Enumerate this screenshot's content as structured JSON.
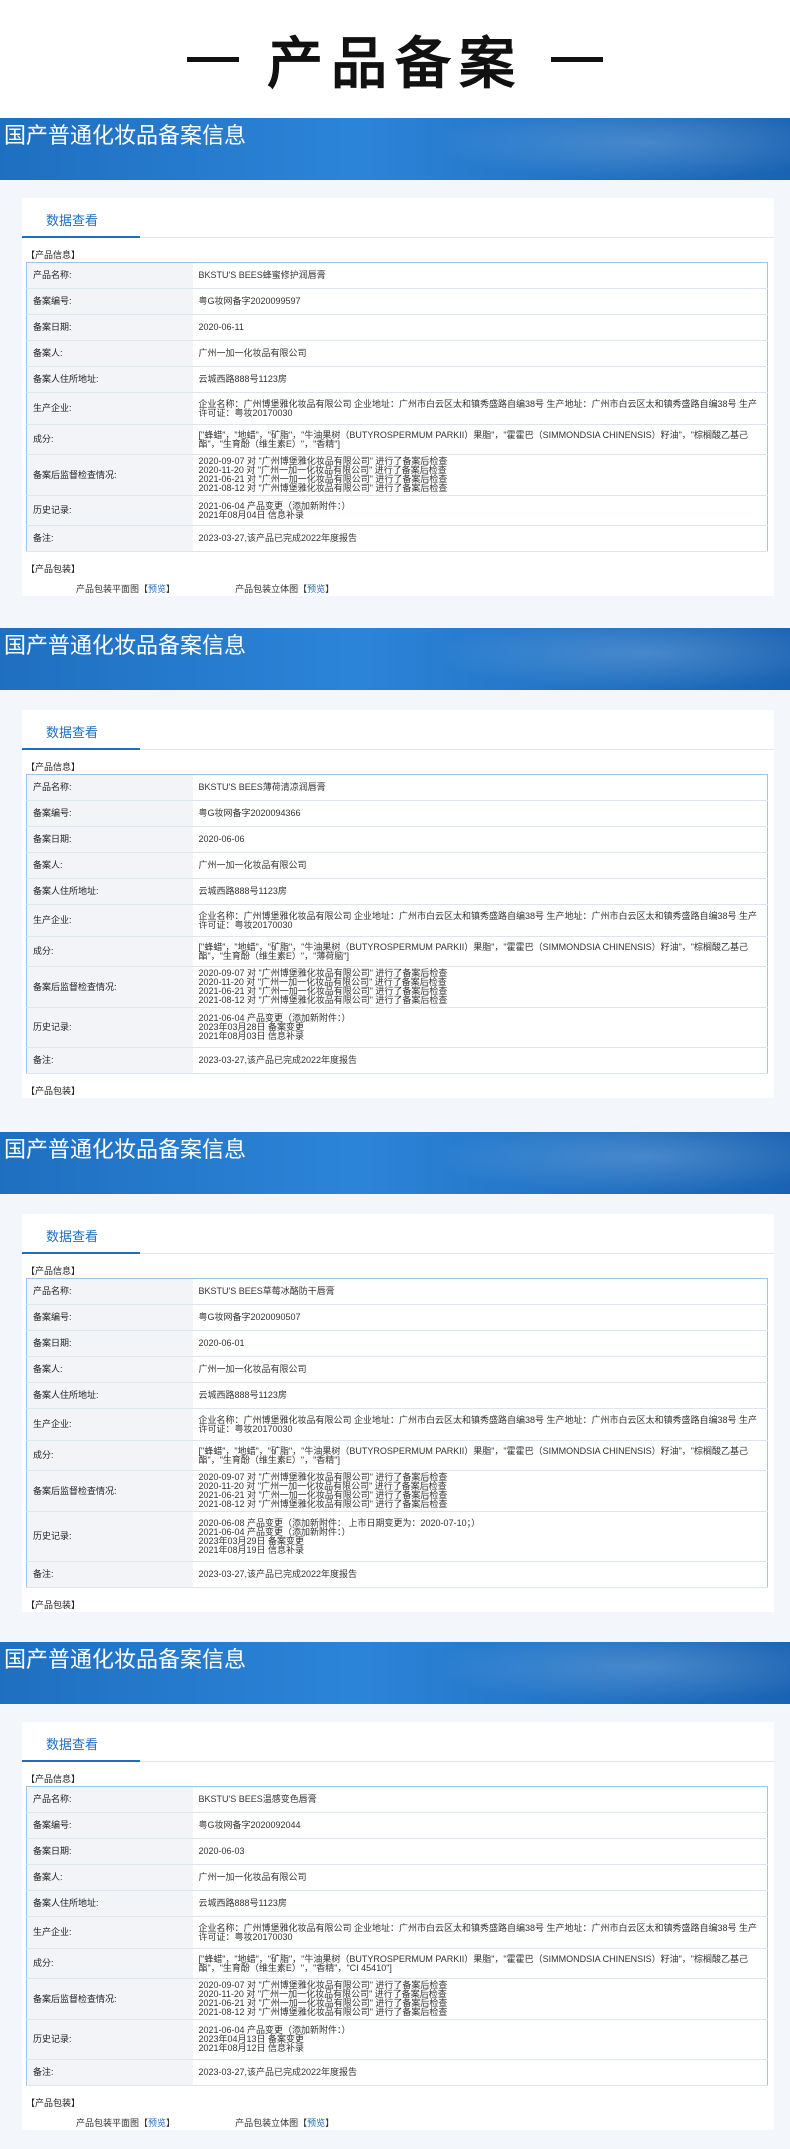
{
  "page_title": "产品备案",
  "records": [
    {
      "banner": "国产普通化妆品备案信息",
      "tab": "数据查看",
      "info_label": "【产品信息】",
      "rows": [
        {
          "k": "产品名称:",
          "v": "BKSTU'S BEES蜂蜜修护润唇膏"
        },
        {
          "k": "备案编号:",
          "v": "粤G妆网备字2020099597"
        },
        {
          "k": "备案日期:",
          "v": "2020-06-11"
        },
        {
          "k": "备案人:",
          "v": "广州一加一化妆品有限公司"
        },
        {
          "k": "备案人住所地址:",
          "v": "云城西路888号1123房"
        },
        {
          "k": "生产企业:",
          "v": "企业名称：广州博堡雅化妆品有限公司 企业地址：广州市白云区太和镇秀盛路自编38号 生产地址：广州市白云区太和镇秀盛路自编38号 生产许可证：粤妆20170030"
        },
        {
          "k": "成分:",
          "v": "[\"蜂蜡\"，\"地蜡\"，\"矿脂\"，\"牛油果树（BUTYROSPERMUM PARKII）果脂\"，\"霍霍巴（SIMMONDSIA CHINENSIS）籽油\"，\"棕榈酸乙基己酯\"，\"生育酚（维生素E）\"，\"香精\"]"
        },
        {
          "k": "备案后监督检查情况:",
          "v": "2020-09-07 对 \"广州博堡雅化妆品有限公司\" 进行了备案后检查\n2020-11-20 对 \"广州一加一化妆品有限公司\" 进行了备案后检查\n2021-06-21 对 \"广州一加一化妆品有限公司\" 进行了备案后检查\n2021-08-12 对 \"广州博堡雅化妆品有限公司\" 进行了备案后检查"
        },
        {
          "k": "历史记录:",
          "v": "2021-06-04 产品变更（添加新附件：）\n2021年08月04日 信息补录"
        },
        {
          "k": "备注:",
          "v": "2023-03-27,该产品已完成2022年度报告"
        }
      ],
      "pack_label": "【产品包装】",
      "pack_items": [
        {
          "name": "产品包装平面图",
          "link": "预览"
        },
        {
          "name": "产品包装立体图",
          "link": "预览"
        }
      ]
    },
    {
      "banner": "国产普通化妆品备案信息",
      "tab": "数据查看",
      "info_label": "【产品信息】",
      "rows": [
        {
          "k": "产品名称:",
          "v": "BKSTU'S BEES薄荷清凉润唇膏"
        },
        {
          "k": "备案编号:",
          "v": "粤G妆网备字2020094366"
        },
        {
          "k": "备案日期:",
          "v": "2020-06-06"
        },
        {
          "k": "备案人:",
          "v": "广州一加一化妆品有限公司"
        },
        {
          "k": "备案人住所地址:",
          "v": "云城西路888号1123房"
        },
        {
          "k": "生产企业:",
          "v": "企业名称：广州博堡雅化妆品有限公司 企业地址：广州市白云区太和镇秀盛路自编38号 生产地址：广州市白云区太和镇秀盛路自编38号 生产许可证：粤妆20170030"
        },
        {
          "k": "成分:",
          "v": "[\"蜂蜡\"，\"地蜡\"，\"矿脂\"，\"牛油果树（BUTYROSPERMUM PARKII）果脂\"，\"霍霍巴（SIMMONDSIA CHINENSIS）籽油\"，\"棕榈酸乙基己酯\"，\"生育酚（维生素E）\"，\"薄荷脑\"]"
        },
        {
          "k": "备案后监督检查情况:",
          "v": "2020-09-07 对 \"广州博堡雅化妆品有限公司\" 进行了备案后检查\n2020-11-20 对 \"广州一加一化妆品有限公司\" 进行了备案后检查\n2021-06-21 对 \"广州一加一化妆品有限公司\" 进行了备案后检查\n2021-08-12 对 \"广州博堡雅化妆品有限公司\" 进行了备案后检查"
        },
        {
          "k": "历史记录:",
          "v": "2021-06-04 产品变更（添加新附件：）\n2023年03月28日 备案变更\n2021年08月03日 信息补录"
        },
        {
          "k": "备注:",
          "v": "2023-03-27,该产品已完成2022年度报告"
        }
      ],
      "pack_label": "【产品包装】",
      "pack_items": []
    },
    {
      "banner": "国产普通化妆品备案信息",
      "tab": "数据查看",
      "info_label": "【产品信息】",
      "rows": [
        {
          "k": "产品名称:",
          "v": "BKSTU'S BEES草莓冰酪防干唇膏"
        },
        {
          "k": "备案编号:",
          "v": "粤G妆网备字2020090507"
        },
        {
          "k": "备案日期:",
          "v": "2020-06-01"
        },
        {
          "k": "备案人:",
          "v": "广州一加一化妆品有限公司"
        },
        {
          "k": "备案人住所地址:",
          "v": "云城西路888号1123房"
        },
        {
          "k": "生产企业:",
          "v": "企业名称：广州博堡雅化妆品有限公司 企业地址：广州市白云区太和镇秀盛路自编38号 生产地址：广州市白云区太和镇秀盛路自编38号 生产许可证：粤妆20170030"
        },
        {
          "k": "成分:",
          "v": "[\"蜂蜡\"，\"地蜡\"，\"矿脂\"，\"牛油果树（BUTYROSPERMUM PARKII）果脂\"，\"霍霍巴（SIMMONDSIA CHINENSIS）籽油\"，\"棕榈酸乙基己酯\"，\"生育酚（维生素E）\"，\"香精\"]"
        },
        {
          "k": "备案后监督检查情况:",
          "v": "2020-09-07 对 \"广州博堡雅化妆品有限公司\" 进行了备案后检查\n2020-11-20 对 \"广州一加一化妆品有限公司\" 进行了备案后检查\n2021-06-21 对 \"广州一加一化妆品有限公司\" 进行了备案后检查\n2021-08-12 对 \"广州博堡雅化妆品有限公司\" 进行了备案后检查"
        },
        {
          "k": "历史记录:",
          "v": "2020-06-08 产品变更（添加新附件：  上市日期变更为：2020-07-10；）\n2021-06-04 产品变更（添加新附件：）\n2023年03月29日 备案变更\n2021年08月19日 信息补录"
        },
        {
          "k": "备注:",
          "v": "2023-03-27,该产品已完成2022年度报告"
        }
      ],
      "pack_label": "【产品包装】",
      "pack_items": []
    },
    {
      "banner": "国产普通化妆品备案信息",
      "tab": "数据查看",
      "info_label": "【产品信息】",
      "rows": [
        {
          "k": "产品名称:",
          "v": "BKSTU'S BEES温感变色唇膏"
        },
        {
          "k": "备案编号:",
          "v": "粤G妆网备字2020092044"
        },
        {
          "k": "备案日期:",
          "v": "2020-06-03"
        },
        {
          "k": "备案人:",
          "v": "广州一加一化妆品有限公司"
        },
        {
          "k": "备案人住所地址:",
          "v": "云城西路888号1123房"
        },
        {
          "k": "生产企业:",
          "v": "企业名称：广州博堡雅化妆品有限公司 企业地址：广州市白云区太和镇秀盛路自编38号 生产地址：广州市白云区太和镇秀盛路自编38号 生产许可证：粤妆20170030"
        },
        {
          "k": "成分:",
          "v": "[\"蜂蜡\"，\"地蜡\"，\"矿脂\"，\"牛油果树（BUTYROSPERMUM PARKII）果脂\"，\"霍霍巴（SIMMONDSIA CHINENSIS）籽油\"，\"棕榈酸乙基己酯\"，\"生育酚（维生素E）\"，\"香精\"，\"CI 45410\"]"
        },
        {
          "k": "备案后监督检查情况:",
          "v": "2020-09-07 对 \"广州博堡雅化妆品有限公司\" 进行了备案后检查\n2020-11-20 对 \"广州一加一化妆品有限公司\" 进行了备案后检查\n2021-06-21 对 \"广州一加一化妆品有限公司\" 进行了备案后检查\n2021-08-12 对 \"广州博堡雅化妆品有限公司\" 进行了备案后检查"
        },
        {
          "k": "历史记录:",
          "v": "2021-06-04 产品变更（添加新附件：）\n2023年04月13日 备案变更\n2021年08月12日 信息补录"
        },
        {
          "k": "备注:",
          "v": "2023-03-27,该产品已完成2022年度报告"
        }
      ],
      "pack_label": "【产品包装】",
      "pack_items": [
        {
          "name": "产品包装平面图",
          "link": "预览"
        },
        {
          "name": "产品包装立体图",
          "link": "预览"
        }
      ]
    }
  ]
}
